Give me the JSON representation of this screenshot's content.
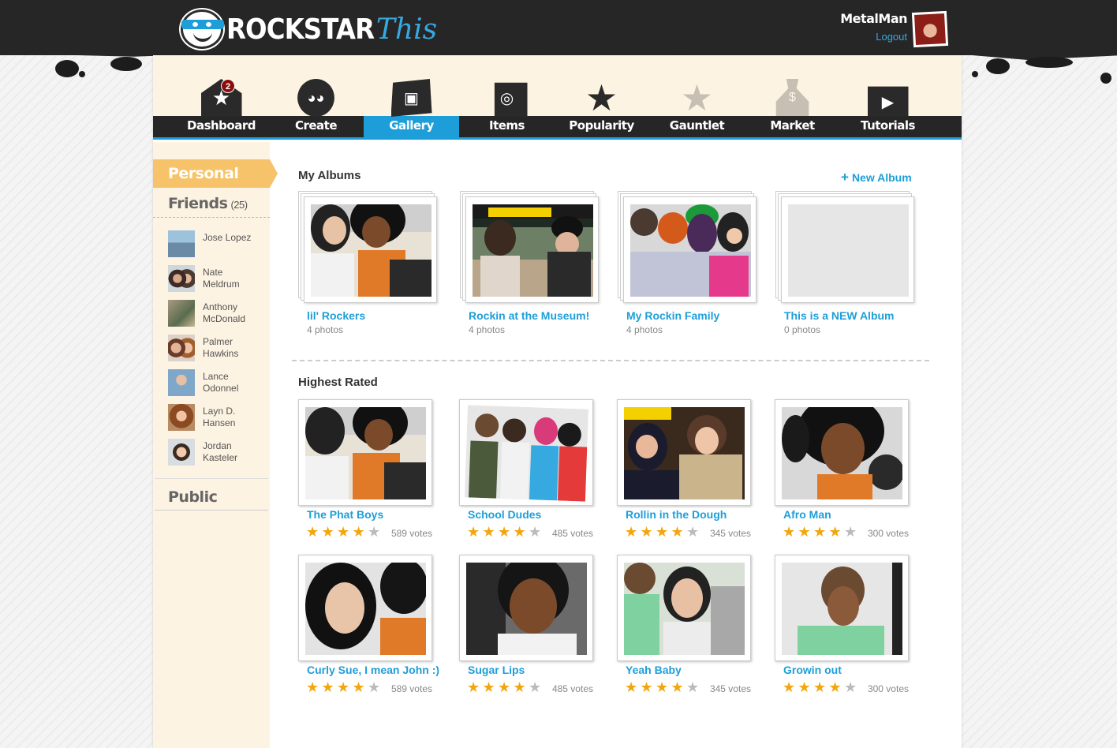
{
  "header": {
    "logo_main": "ROCKSTAR",
    "logo_this": "This",
    "username": "MetalMan",
    "logout_label": "Logout"
  },
  "nav": {
    "items": [
      {
        "label": "Dashboard",
        "icon": "house-star-icon",
        "badge": "2",
        "active": false
      },
      {
        "label": "Create",
        "icon": "kiss-face-icon",
        "active": false
      },
      {
        "label": "Gallery",
        "icon": "photo-gallery-icon",
        "active": true
      },
      {
        "label": "Items",
        "icon": "guitar-amp-icon",
        "active": false
      },
      {
        "label": "Popularity",
        "icon": "star-icon",
        "active": false
      },
      {
        "label": "Gauntlet",
        "icon": "fist-star-icon",
        "active": false
      },
      {
        "label": "Market",
        "icon": "money-bag-icon",
        "active": false
      },
      {
        "label": "Tutorials",
        "icon": "play-icon",
        "active": false
      }
    ]
  },
  "sidebar": {
    "personal_label": "Personal",
    "friends_label": "Friends",
    "friends_count": "(25)",
    "public_label": "Public",
    "friends": [
      {
        "name": "Jose Lopez"
      },
      {
        "name": "Nate Meldrum"
      },
      {
        "name": "Anthony McDonald"
      },
      {
        "name": "Palmer Hawkins"
      },
      {
        "name": "Lance Odonnel"
      },
      {
        "name": "Layn D. Hansen"
      },
      {
        "name": "Jordan Kasteler"
      }
    ]
  },
  "albums": {
    "title": "My Albums",
    "new_album_label": "New Album",
    "items": [
      {
        "title": "lil' Rockers",
        "count": "4 photos"
      },
      {
        "title": "Rockin at the Museum!",
        "count": "4 photos"
      },
      {
        "title": "My Rockin Family",
        "count": "4 photos"
      },
      {
        "title": "This is a NEW Album",
        "count": "0 photos"
      }
    ]
  },
  "highest_rated": {
    "title": "Highest Rated",
    "items": [
      {
        "title": "The Phat Boys",
        "votes": "589 votes",
        "rating": 4
      },
      {
        "title": "School Dudes",
        "votes": "485 votes",
        "rating": 4
      },
      {
        "title": "Rollin in the Dough",
        "votes": "345 votes",
        "rating": 4
      },
      {
        "title": "Afro Man",
        "votes": "300 votes",
        "rating": 4
      },
      {
        "title": "Curly Sue, I mean John :)",
        "votes": "589 votes",
        "rating": 4
      },
      {
        "title": "Sugar Lips",
        "votes": "485 votes",
        "rating": 4
      },
      {
        "title": "Yeah Baby",
        "votes": "345 votes",
        "rating": 4
      },
      {
        "title": "Growin out",
        "votes": "300 votes",
        "rating": 4
      }
    ]
  },
  "colors": {
    "accent": "#1e9ed9",
    "tab_active": "#f6c36a",
    "star": "#f2a60c",
    "dark": "#262626"
  }
}
